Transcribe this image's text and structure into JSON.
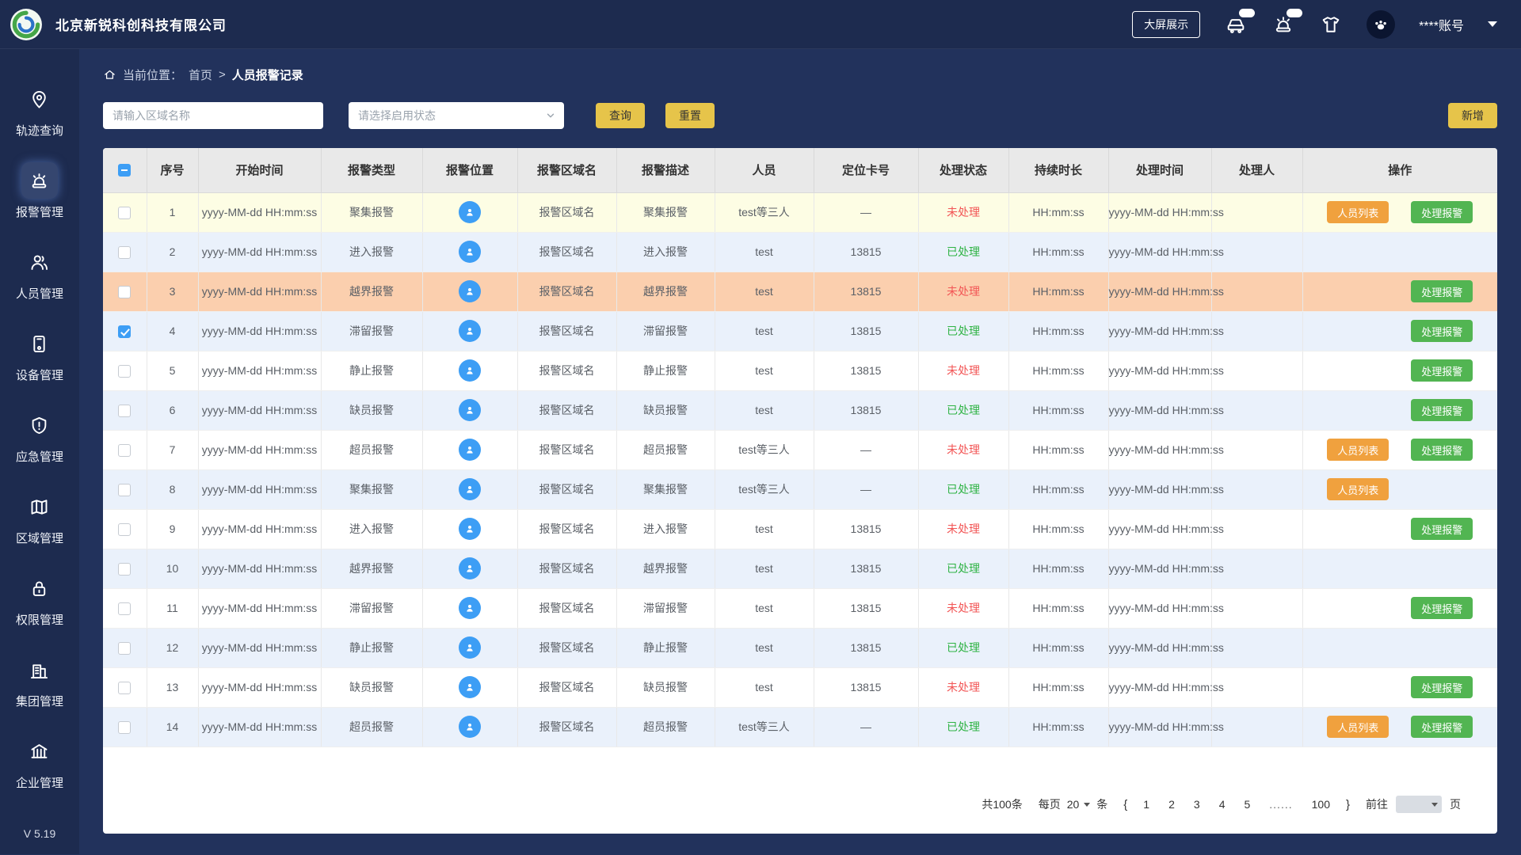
{
  "header": {
    "company": "北京新锐科创科技有限公司",
    "big_screen": "大屏展示",
    "account": "****账号"
  },
  "sidebar": {
    "items": [
      {
        "label": "轨迹查询",
        "icon": "trajectory-icon",
        "active": false
      },
      {
        "label": "报警管理",
        "icon": "alarm-icon",
        "active": true
      },
      {
        "label": "人员管理",
        "icon": "personnel-icon",
        "active": false
      },
      {
        "label": "设备管理",
        "icon": "device-icon",
        "active": false
      },
      {
        "label": "应急管理",
        "icon": "emergency-icon",
        "active": false
      },
      {
        "label": "区域管理",
        "icon": "region-icon",
        "active": false
      },
      {
        "label": "权限管理",
        "icon": "permission-icon",
        "active": false
      },
      {
        "label": "集团管理",
        "icon": "group-icon",
        "active": false
      },
      {
        "label": "企业管理",
        "icon": "enterprise-icon",
        "active": false
      }
    ],
    "version": "V 5.19"
  },
  "breadcrumb": {
    "label": "当前位置：",
    "home": "首页",
    "separator": ">",
    "current": "人员报警记录"
  },
  "filters": {
    "area_input_placeholder": "请输入区域名称",
    "status_select_placeholder": "请选择启用状态",
    "query": "查询",
    "reset": "重置",
    "add": "新增"
  },
  "table": {
    "columns": [
      "序号",
      "开始时间",
      "报警类型",
      "报警位置",
      "报警区域名",
      "报警描述",
      "人员",
      "定位卡号",
      "处理状态",
      "持续时长",
      "处理时间",
      "处理人",
      "操作"
    ],
    "action_labels": {
      "person_list": "人员列表",
      "handle": "处理报警"
    },
    "status_labels": {
      "pending": "未处理",
      "done": "已处理"
    },
    "rows": [
      {
        "no": "1",
        "start": "yyyy-MM-dd HH:mm:ss",
        "type": "聚集报警",
        "area": "报警区域名",
        "desc": "聚集报警",
        "person": "test等三人",
        "card": "—",
        "status": "pending",
        "duration": "HH:mm:ss",
        "handled_at": "yyyy-MM-dd HH:mm:ss",
        "handler": "",
        "bg": "yellow",
        "checked": false,
        "actions": [
          "person_list",
          "handle"
        ]
      },
      {
        "no": "2",
        "start": "yyyy-MM-dd HH:mm:ss",
        "type": "进入报警",
        "area": "报警区域名",
        "desc": "进入报警",
        "person": "test",
        "card": "13815",
        "status": "done",
        "duration": "HH:mm:ss",
        "handled_at": "yyyy-MM-dd HH:mm:ss",
        "handler": "",
        "bg": "blue",
        "checked": false,
        "actions": []
      },
      {
        "no": "3",
        "start": "yyyy-MM-dd HH:mm:ss",
        "type": "越界报警",
        "area": "报警区域名",
        "desc": "越界报警",
        "person": "test",
        "card": "13815",
        "status": "pending",
        "duration": "HH:mm:ss",
        "handled_at": "yyyy-MM-dd HH:mm:ss",
        "handler": "",
        "bg": "salmon",
        "checked": false,
        "actions": [
          "handle"
        ]
      },
      {
        "no": "4",
        "start": "yyyy-MM-dd HH:mm:ss",
        "type": "滞留报警",
        "area": "报警区域名",
        "desc": "滞留报警",
        "person": "test",
        "card": "13815",
        "status": "done",
        "duration": "HH:mm:ss",
        "handled_at": "yyyy-MM-dd HH:mm:ss",
        "handler": "",
        "bg": "blue",
        "checked": true,
        "actions": [
          "handle"
        ]
      },
      {
        "no": "5",
        "start": "yyyy-MM-dd HH:mm:ss",
        "type": "静止报警",
        "area": "报警区域名",
        "desc": "静止报警",
        "person": "test",
        "card": "13815",
        "status": "pending",
        "duration": "HH:mm:ss",
        "handled_at": "yyyy-MM-dd HH:mm:ss",
        "handler": "",
        "bg": "white",
        "checked": false,
        "actions": [
          "handle"
        ]
      },
      {
        "no": "6",
        "start": "yyyy-MM-dd HH:mm:ss",
        "type": "缺员报警",
        "area": "报警区域名",
        "desc": "缺员报警",
        "person": "test",
        "card": "13815",
        "status": "done",
        "duration": "HH:mm:ss",
        "handled_at": "yyyy-MM-dd HH:mm:ss",
        "handler": "",
        "bg": "blue",
        "checked": false,
        "actions": [
          "handle"
        ]
      },
      {
        "no": "7",
        "start": "yyyy-MM-dd HH:mm:ss",
        "type": "超员报警",
        "area": "报警区域名",
        "desc": "超员报警",
        "person": "test等三人",
        "card": "—",
        "status": "pending",
        "duration": "HH:mm:ss",
        "handled_at": "yyyy-MM-dd HH:mm:ss",
        "handler": "",
        "bg": "white",
        "checked": false,
        "actions": [
          "person_list",
          "handle"
        ]
      },
      {
        "no": "8",
        "start": "yyyy-MM-dd HH:mm:ss",
        "type": "聚集报警",
        "area": "报警区域名",
        "desc": "聚集报警",
        "person": "test等三人",
        "card": "—",
        "status": "done",
        "duration": "HH:mm:ss",
        "handled_at": "yyyy-MM-dd HH:mm:ss",
        "handler": "",
        "bg": "blue",
        "checked": false,
        "actions": [
          "person_list"
        ]
      },
      {
        "no": "9",
        "start": "yyyy-MM-dd HH:mm:ss",
        "type": "进入报警",
        "area": "报警区域名",
        "desc": "进入报警",
        "person": "test",
        "card": "13815",
        "status": "pending",
        "duration": "HH:mm:ss",
        "handled_at": "yyyy-MM-dd HH:mm:ss",
        "handler": "",
        "bg": "white",
        "checked": false,
        "actions": [
          "handle"
        ]
      },
      {
        "no": "10",
        "start": "yyyy-MM-dd HH:mm:ss",
        "type": "越界报警",
        "area": "报警区域名",
        "desc": "越界报警",
        "person": "test",
        "card": "13815",
        "status": "done",
        "duration": "HH:mm:ss",
        "handled_at": "yyyy-MM-dd HH:mm:ss",
        "handler": "",
        "bg": "blue",
        "checked": false,
        "actions": []
      },
      {
        "no": "11",
        "start": "yyyy-MM-dd HH:mm:ss",
        "type": "滞留报警",
        "area": "报警区域名",
        "desc": "滞留报警",
        "person": "test",
        "card": "13815",
        "status": "pending",
        "duration": "HH:mm:ss",
        "handled_at": "yyyy-MM-dd HH:mm:ss",
        "handler": "",
        "bg": "white",
        "checked": false,
        "actions": [
          "handle"
        ]
      },
      {
        "no": "12",
        "start": "yyyy-MM-dd HH:mm:ss",
        "type": "静止报警",
        "area": "报警区域名",
        "desc": "静止报警",
        "person": "test",
        "card": "13815",
        "status": "done",
        "duration": "HH:mm:ss",
        "handled_at": "yyyy-MM-dd HH:mm:ss",
        "handler": "",
        "bg": "blue",
        "checked": false,
        "actions": []
      },
      {
        "no": "13",
        "start": "yyyy-MM-dd HH:mm:ss",
        "type": "缺员报警",
        "area": "报警区域名",
        "desc": "缺员报警",
        "person": "test",
        "card": "13815",
        "status": "pending",
        "duration": "HH:mm:ss",
        "handled_at": "yyyy-MM-dd HH:mm:ss",
        "handler": "",
        "bg": "white",
        "checked": false,
        "actions": [
          "handle"
        ]
      },
      {
        "no": "14",
        "start": "yyyy-MM-dd HH:mm:ss",
        "type": "超员报警",
        "area": "报警区域名",
        "desc": "超员报警",
        "person": "test等三人",
        "card": "—",
        "status": "done",
        "duration": "HH:mm:ss",
        "handled_at": "yyyy-MM-dd HH:mm:ss",
        "handler": "",
        "bg": "blue",
        "checked": false,
        "actions": [
          "person_list",
          "handle"
        ]
      }
    ]
  },
  "pagination": {
    "total": "共100条",
    "per_page_prefix": "每页",
    "per_page_value": "20",
    "per_page_suffix": "条",
    "prev": "{",
    "next": "}",
    "pages": [
      "1",
      "2",
      "3",
      "4",
      "5",
      "......",
      "100"
    ],
    "goto_prefix": "前往",
    "goto_suffix": "页"
  },
  "colors": {
    "navy": "#1d2b4f",
    "content_bg": "#22325c",
    "accent_gold": "#e6c44a",
    "button_orange": "#f0a13e",
    "button_green": "#52b552",
    "status_pending": "#f25555",
    "status_done": "#2fb344",
    "row_yellow": "#fdfde4",
    "row_blue": "#eaf1fb",
    "row_salmon": "#fbcfae",
    "icon_blue": "#3d9ef5"
  },
  "icons": [
    "app-logo",
    "vehicle-icon",
    "siren-icon",
    "clothing-icon",
    "avatar-paw-icon",
    "caret-down-icon",
    "home-icon",
    "chevron-down-icon",
    "trajectory-icon",
    "alarm-icon",
    "personnel-icon",
    "device-icon",
    "emergency-icon",
    "region-icon",
    "permission-icon",
    "group-icon",
    "enterprise-icon",
    "location-person-icon"
  ]
}
